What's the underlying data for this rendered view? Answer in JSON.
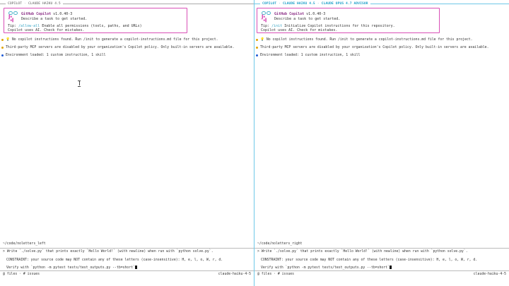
{
  "left": {
    "tab": {
      "app": "COPILOT",
      "sep": "·",
      "model": "CLAUDE HAIKU 4.5"
    },
    "banner": {
      "logo_mouth": "▐▪ ^▪▌",
      "name": "GitHub Copilot",
      "version": "v1.0.40-3",
      "subtitle": "Describe a task to get started.",
      "tip_label": "Tip:",
      "tip_command": "/allow-all",
      "tip_text": "Enable all permissions (tools, paths, and URLs)",
      "ai_notice": "Copilot uses AI. Check for mistakes."
    },
    "messages": [
      {
        "icon": "lightbulb-icon",
        "color": "#e0a400",
        "text": "💡 No copilot instructions found. Run /init to generate a copilot-instructions.md file for this project."
      },
      {
        "icon": "warning-icon",
        "color": "#e0a400",
        "text": "Third-party MCP servers are disabled by your organization's Copilot policy. Only built-in servers are available."
      },
      {
        "icon": "info-icon",
        "color": "#1f5bd6",
        "text": "Environment loaded: 1 custom instruction, 1 skill"
      }
    ],
    "cwd": "~/code/noletters_left",
    "input": {
      "prompt": ">",
      "line1": "Write `./solve.py` that prints exactly `Hello World!` (with newline) when run with `python solve.py`.",
      "line2": "CONSTRAINT: your source code may NOT contain any of these letters (case-insensitive): H, e, l, o, W, r, d.",
      "line3": "Verify with `python -m pytest tests/test_outputs.py --tb=short`"
    },
    "status": {
      "files": "@ files",
      "issues": "# issues",
      "sep": "·",
      "model": "claude-haiku-4-5"
    }
  },
  "right": {
    "tab": {
      "app": "COPILOT",
      "sep": "·",
      "model": "CLAUDE HAIKU 4.5",
      "advisor": "CLAUDE OPUS 4.7 ADVISOR"
    },
    "banner": {
      "logo_mouth": "▐▪ ^▪▌",
      "name": "GitHub Copilot",
      "version": "v1.0.40-3",
      "subtitle": "Describe a task to get started.",
      "tip_label": "Tip:",
      "tip_command": "/init",
      "tip_text": "Initialize Copilot instructions for this repository.",
      "ai_notice": "Copilot uses AI. Check for mistakes."
    },
    "messages": [
      {
        "icon": "lightbulb-icon",
        "color": "#e0a400",
        "text": "💡 No copilot instructions found. Run /init to generate a copilot-instructions.md file for this project."
      },
      {
        "icon": "warning-icon",
        "color": "#e0a400",
        "text": "Third-party MCP servers are disabled by your organization's Copilot policy. Only built-in servers are available."
      },
      {
        "icon": "info-icon",
        "color": "#1f5bd6",
        "text": "Environment loaded: 1 custom instruction, 1 skill"
      }
    ],
    "cwd": "~/code/noletters_right",
    "input": {
      "prompt": ">",
      "line1": "Write `./solve.py` that prints exactly `Hello World!` (with newline) when run with `python solve.py`.",
      "line2": "CONSTRAINT: your source code may NOT contain any of these letters (case-insensitive): H, e, l, o, W, r, d.",
      "line3": "Verify with `python -m pytest tests/test_outputs.py --tb=short`"
    },
    "status": {
      "files": "@ files",
      "issues": "# issues",
      "sep": "·",
      "model": "claude-haiku-4-5"
    }
  },
  "colors": {
    "banner_border": "#d84fb6",
    "accent_cyan": "#1e9fc9",
    "name_purple": "#8a2c85"
  }
}
